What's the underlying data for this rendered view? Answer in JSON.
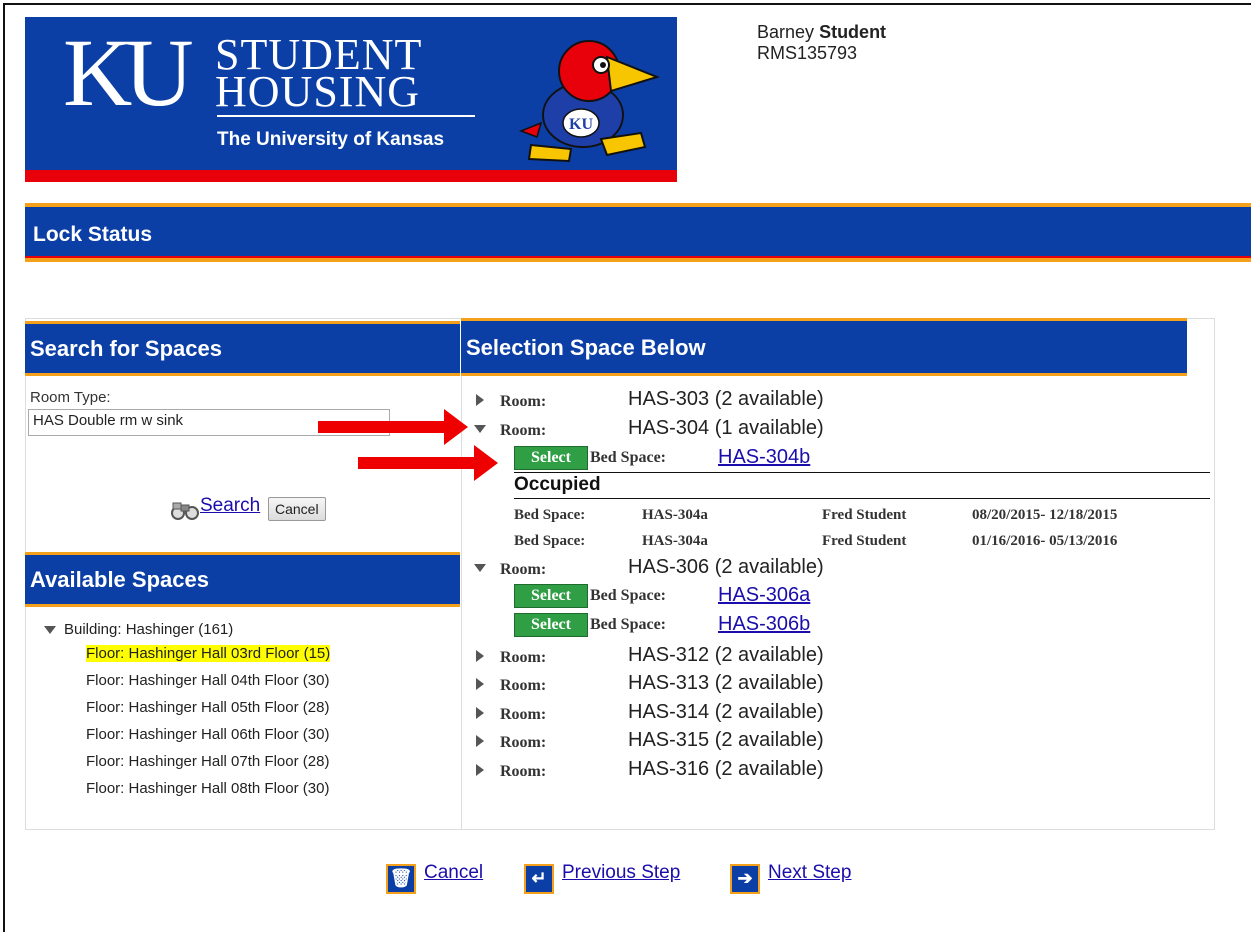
{
  "banner": {
    "ku": "KU",
    "line1": "STUDENT",
    "line2": "HOUSING",
    "university": "The University of Kansas",
    "mascot_icon": "jayhawk-mascot"
  },
  "user": {
    "first": "Barney",
    "last": "Student",
    "id": "RMS135793"
  },
  "page_title": "Lock Status",
  "search": {
    "heading": "Search for Spaces",
    "room_type_label": "Room Type:",
    "room_type_value": "HAS Double rm w sink",
    "search_link": "Search",
    "cancel_button": "Cancel",
    "search_icon": "binoculars-icon"
  },
  "available": {
    "heading": "Available Spaces",
    "building": "Building: Hashinger (161)",
    "floors": [
      "Floor: Hashinger Hall 03rd Floor (15)",
      "Floor: Hashinger Hall 04th Floor (30)",
      "Floor: Hashinger Hall 05th Floor (28)",
      "Floor: Hashinger Hall 06th Floor (30)",
      "Floor: Hashinger Hall 07th Floor (28)",
      "Floor: Hashinger Hall 08th Floor (30)"
    ]
  },
  "selection": {
    "heading": "Selection Space Below",
    "room_label": "Room:",
    "bed_label": "Bed Space:",
    "select_label": "Select",
    "rooms": [
      "HAS-303 (2 available)",
      "HAS-304 (1 available)",
      "HAS-306 (2 available)",
      "HAS-312 (2 available)",
      "HAS-313 (2 available)",
      "HAS-314 (2 available)",
      "HAS-315 (2 available)",
      "HAS-316 (2 available)"
    ],
    "beds": [
      "HAS-304b",
      "HAS-306a",
      "HAS-306b"
    ],
    "occupied_heading": "Occupied",
    "occupied": [
      {
        "label": "Bed Space:",
        "space": "HAS-304a",
        "name": "Fred Student",
        "dates": "08/20/2015- 12/18/2015"
      },
      {
        "label": "Bed Space:",
        "space": "HAS-304a",
        "name": "Fred Student",
        "dates": "01/16/2016- 05/13/2016"
      }
    ]
  },
  "footer": {
    "cancel": "Cancel",
    "previous": "Previous Step",
    "next": "Next Step"
  },
  "colors": {
    "ku_blue": "#0b3fa5",
    "ku_red": "#e8000b",
    "accent_gold": "#f5a01a",
    "select_green": "#2f9e44",
    "highlight": "#ffff00"
  }
}
